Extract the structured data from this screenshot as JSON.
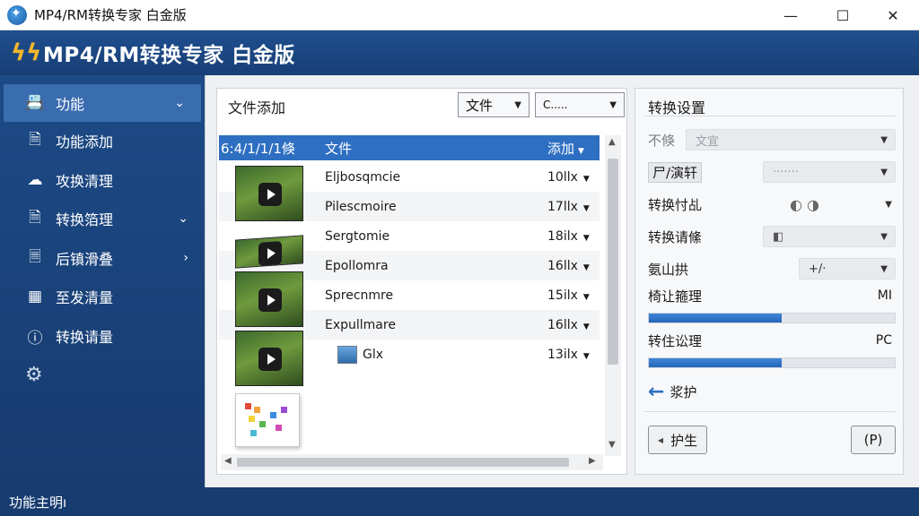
{
  "window": {
    "title": "MP4/RM转换专家 白金版",
    "minimize": "—",
    "maximize": "☐",
    "close": "✕"
  },
  "banner": {
    "logo_glyph": "ϟϟ",
    "title": "MP4/RM转换专家 白金版"
  },
  "sidebar": {
    "items": [
      {
        "label": "功能",
        "icon": "📇",
        "chevron": "⌄"
      },
      {
        "label": "功能添加",
        "icon": "🗎",
        "chevron": ""
      },
      {
        "label": "攻换清理",
        "icon": "☁",
        "chevron": ""
      },
      {
        "label": "转换箔理",
        "icon": "🗎",
        "chevron": "⌄"
      },
      {
        "label": "后镇滑叠",
        "icon": "🗏",
        "chevron": "›"
      },
      {
        "label": "至发清量",
        "icon": "▦",
        "chevron": ""
      },
      {
        "label": "转换请量",
        "icon": "ⓘ",
        "chevron": ""
      }
    ],
    "gear_icon": "⚙"
  },
  "file_panel": {
    "title": "文件添加",
    "filter1": "文件",
    "filter2": "C.....",
    "columns": [
      "6:4/1/1/1倏",
      "文件",
      "添加"
    ],
    "rows": [
      {
        "name": "Eljbosqmcie",
        "size": "10llx"
      },
      {
        "name": "Pilescmoire",
        "size": "17llx"
      },
      {
        "name": "Sergtomie",
        "size": "18ilx"
      },
      {
        "name": "Epollomra",
        "size": "16llx"
      },
      {
        "name": "Sprecnmre",
        "size": "15ilx"
      },
      {
        "name": "Expullmare",
        "size": "16llx"
      },
      {
        "name": "Glx",
        "size": "13ilx"
      }
    ]
  },
  "settings": {
    "title": "转换设置",
    "row1_label": "不倏",
    "row1_value": "文宜",
    "row2_label": "尸/演轩",
    "row2_value": "·······",
    "row3_label": "转换忖乩",
    "row4_label": "转换请絛",
    "row5_label": "氨山拱",
    "row5_value": "+/·",
    "progress1_label": "椅让箍理",
    "progress1_value": "MI",
    "progress1_percent": 54,
    "progress2_label": "转住讼理",
    "progress2_value": "PC",
    "progress2_percent": 54,
    "back_label": "浆护",
    "prev_button": "护生",
    "next_button": "(P)"
  },
  "statusbar": {
    "text": "功能主明ı"
  }
}
